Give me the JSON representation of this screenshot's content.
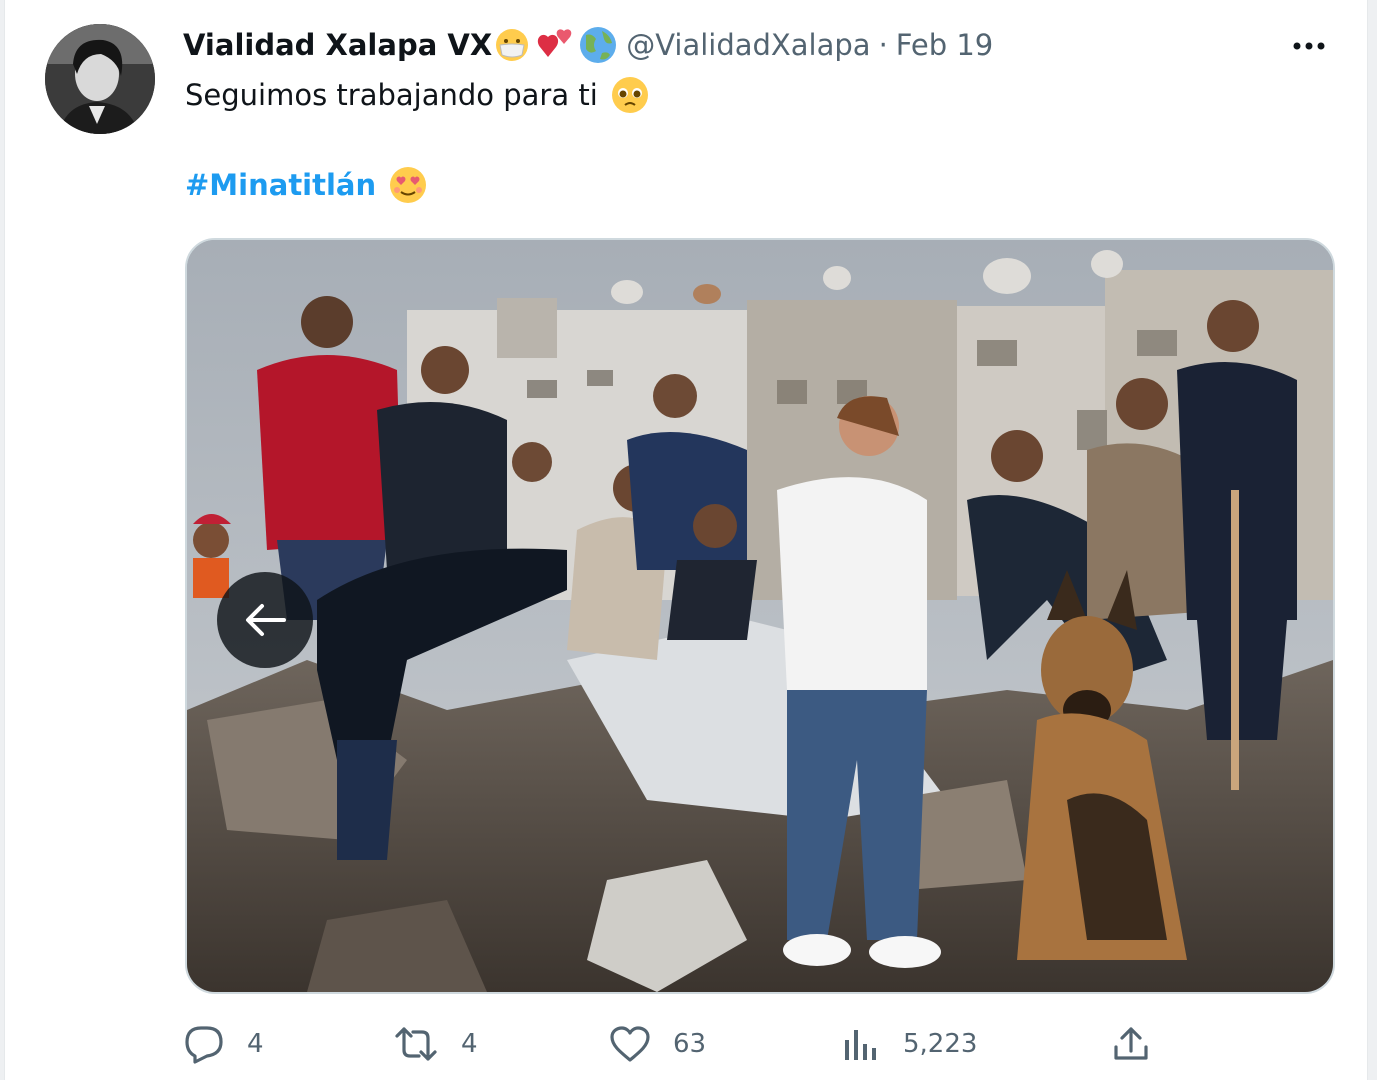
{
  "tweet": {
    "author_name": "Vialidad Xalapa VX",
    "name_emojis": [
      "face-with-mask-emoji",
      "two-hearts-emoji",
      "globe-emoji"
    ],
    "handle": "@VialidadXalapa",
    "separator": "·",
    "date": "Feb 19",
    "text_line1": "Seguimos trabajando para ti",
    "hashtag": "#Minatitlán",
    "emoji_line1": "pleading-face-emoji",
    "emoji_line2": "heart-eyes-face-emoji"
  },
  "media": {
    "description_icon": "photo",
    "prev_button_icon": "arrow-left-icon"
  },
  "actions": {
    "replies": "4",
    "retweets": "4",
    "likes": "63",
    "views": "5,223"
  },
  "colors": {
    "accent": "#1d9bf0",
    "muted_text": "#536471",
    "primary_text": "#0f1419"
  }
}
